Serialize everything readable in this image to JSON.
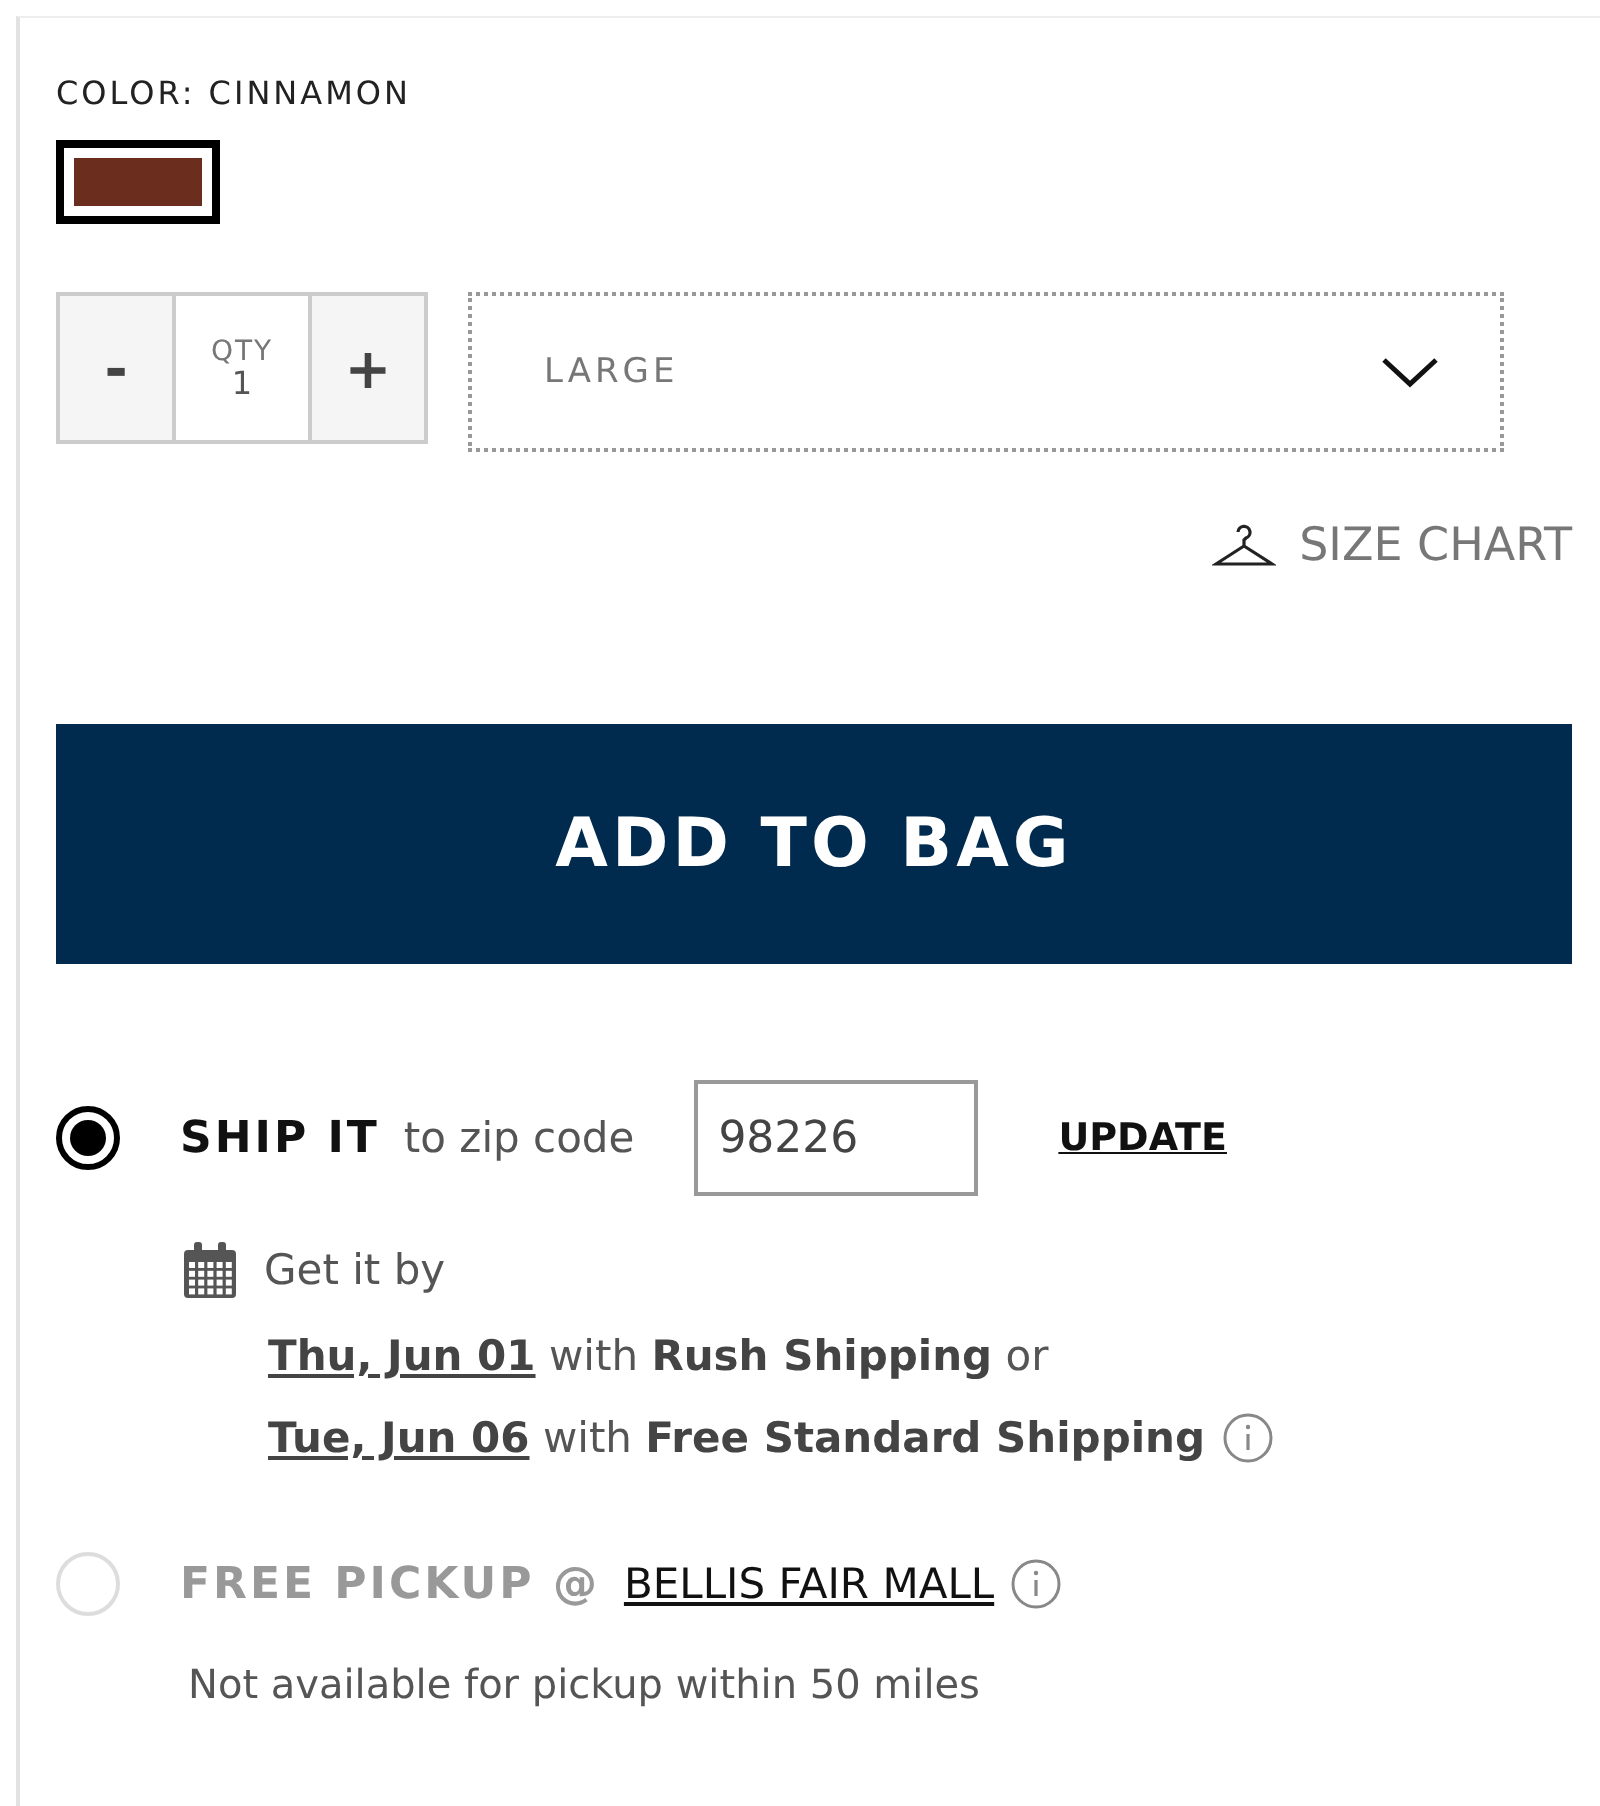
{
  "color": {
    "label": "COLOR: CINNAMON",
    "swatches": [
      {
        "color": "#6b2e1e",
        "selected": true
      }
    ]
  },
  "quantity": {
    "decrement": "-",
    "label": "QTY",
    "value": "1",
    "increment": "+"
  },
  "size_select": {
    "value": "LARGE"
  },
  "size_chart": "SIZE CHART",
  "add_button": "ADD TO BAG",
  "fulfillment": [
    {
      "kind": "ship",
      "selected": true,
      "disabled": false,
      "title": "SHIP IT",
      "text": "to zip code",
      "zip": "98226",
      "action": "UPDATE",
      "get_by": "Get it by",
      "options": [
        {
          "date": "Thu, Jun 01",
          "text": "with **Rush Shipping** or",
          "info": false
        },
        {
          "date": "Tue, Jun 06",
          "text": "with **Free Standard Shipping**",
          "info": true
        }
      ]
    },
    {
      "kind": "pickup",
      "selected": false,
      "disabled": true,
      "title": "FREE PICKUP @",
      "store": "BELLIS FAIR MALL",
      "note": "Not available for pickup within 50 miles"
    }
  ]
}
